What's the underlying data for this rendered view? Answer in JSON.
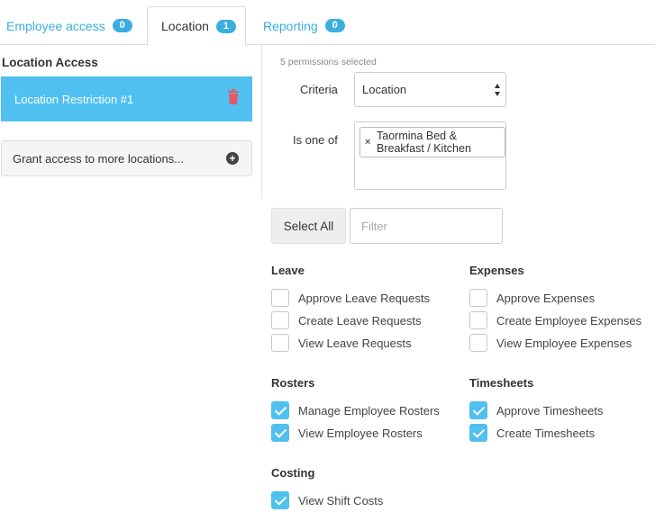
{
  "tabs": [
    {
      "label": "Employee access",
      "count": "0",
      "active": false
    },
    {
      "label": "Location",
      "count": "1",
      "active": true
    },
    {
      "label": "Reporting",
      "count": "0",
      "active": false
    }
  ],
  "left": {
    "title": "Location Access",
    "restriction_label": "Location Restriction #1",
    "grant_label": "Grant access to more locations..."
  },
  "form": {
    "permissions_selected": "5 permissions selected",
    "criteria_label": "Criteria",
    "criteria_value": "Location",
    "is_one_of_label": "Is one of",
    "chip_text": "Taormina Bed & Breakfast / Kitchen",
    "select_all_label": "Select All",
    "filter_placeholder": "Filter"
  },
  "groups": {
    "leave": {
      "title": "Leave",
      "items": [
        {
          "label": "Approve Leave Requests",
          "checked": false
        },
        {
          "label": "Create Leave Requests",
          "checked": false
        },
        {
          "label": "View Leave Requests",
          "checked": false
        }
      ]
    },
    "expenses": {
      "title": "Expenses",
      "items": [
        {
          "label": "Approve Expenses",
          "checked": false
        },
        {
          "label": "Create Employee Expenses",
          "checked": false
        },
        {
          "label": "View Employee Expenses",
          "checked": false
        }
      ]
    },
    "rosters": {
      "title": "Rosters",
      "items": [
        {
          "label": "Manage Employee Rosters",
          "checked": true
        },
        {
          "label": "View Employee Rosters",
          "checked": true
        }
      ]
    },
    "timesheets": {
      "title": "Timesheets",
      "items": [
        {
          "label": "Approve Timesheets",
          "checked": true
        },
        {
          "label": "Create Timesheets",
          "checked": true
        }
      ]
    },
    "costing": {
      "title": "Costing",
      "items": [
        {
          "label": "View Shift Costs",
          "checked": true
        }
      ]
    }
  },
  "colors": {
    "accent": "#4fc0ef",
    "tab_link": "#3aaee0",
    "trash": "#e05a6a"
  }
}
